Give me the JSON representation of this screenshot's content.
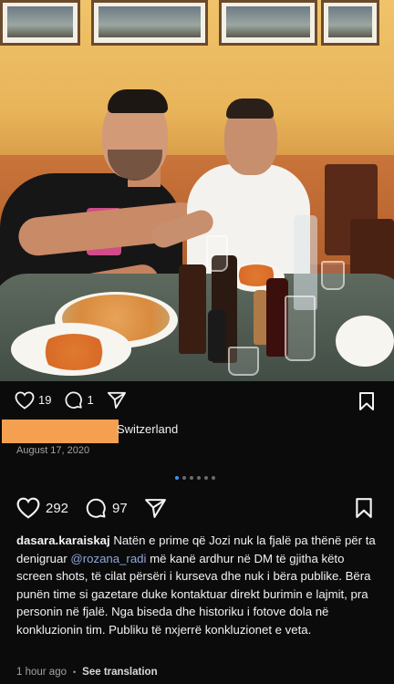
{
  "post1": {
    "like_count": "19",
    "comment_count": "1",
    "location": "Switzerland",
    "date": "August 17, 2020"
  },
  "carousel": {
    "count": 6,
    "active_index": 0
  },
  "post2": {
    "like_count": "292",
    "comment_count": "97",
    "username": "dasara.karaiskaj",
    "caption_part1": "Natën e prime që Jozi nuk la fjalë pa thënë për ta denigruar ",
    "mention": "@rozana_radi",
    "caption_part2": "  më kanë ardhur në DM të gjitha këto screen shots, të cilat përsëri i kurseva dhe nuk i bëra publike. Bëra punën time si gazetare duke kontaktuar direkt burimin e lajmit, pra personin në fjalë.  Nga biseda dhe historiku i fotove  dola në konkluzionin tim. Publiku të nxjerrë konkluzionet e veta.",
    "time_ago": "1 hour ago",
    "separator": "•",
    "see_translation": "See translation"
  },
  "icons": {
    "like": "heart-icon",
    "comment": "comment-icon",
    "share": "send-icon",
    "save": "bookmark-icon"
  },
  "colors": {
    "background": "#0b0b0c",
    "redaction": "#f5a050",
    "active_dot": "#3897f0",
    "mention": "#8ea9d8"
  }
}
